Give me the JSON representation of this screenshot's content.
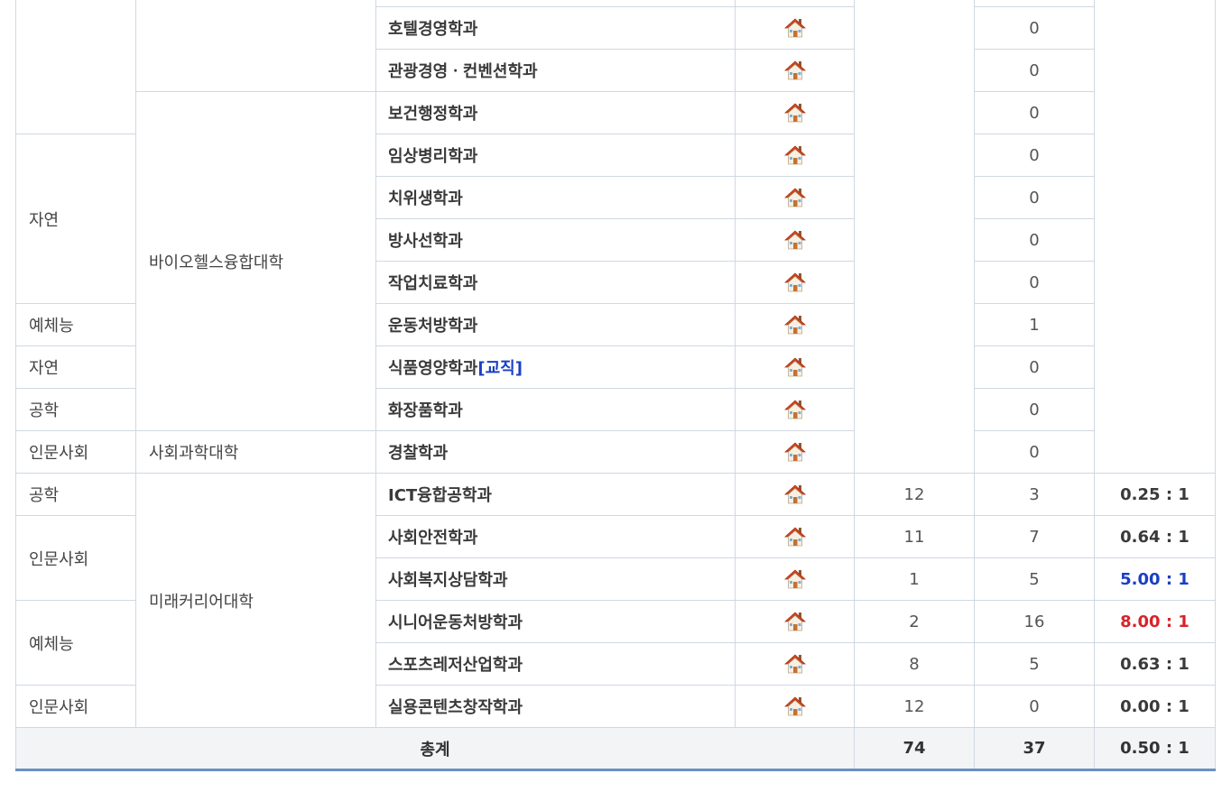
{
  "rows": [
    {
      "field": "",
      "college": "",
      "dept": "",
      "tag": "",
      "applicants": "",
      "count": "",
      "ratio": ""
    },
    {
      "field": "",
      "college": "",
      "dept": "호텔경영학과",
      "tag": "",
      "count": "0"
    },
    {
      "field": "",
      "college": "",
      "dept": "관광경영ㆍ컨벤션학과",
      "tag": "",
      "count": "0"
    },
    {
      "field": "",
      "college": "바이오헬스융합대학",
      "dept": "보건행정학과",
      "tag": "",
      "count": "0"
    },
    {
      "field": "자연",
      "college": "",
      "dept": "임상병리학과",
      "tag": "",
      "count": "0"
    },
    {
      "field": "",
      "college": "",
      "dept": "치위생학과",
      "tag": "",
      "count": "0"
    },
    {
      "field": "",
      "college": "",
      "dept": "방사선학과",
      "tag": "",
      "count": "0"
    },
    {
      "field": "",
      "college": "",
      "dept": "작업치료학과",
      "tag": "",
      "count": "0"
    },
    {
      "field": "예체능",
      "college": "",
      "dept": "운동처방학과",
      "tag": "",
      "count": "1"
    },
    {
      "field": "자연",
      "college": "",
      "dept": "식품영양학과",
      "tag": "[교직]",
      "count": "0"
    },
    {
      "field": "공학",
      "college": "",
      "dept": "화장품학과",
      "tag": "",
      "count": "0"
    },
    {
      "field": "인문사회",
      "college": "사회과학대학",
      "dept": "경찰학과",
      "tag": "",
      "count": "0"
    },
    {
      "field": "공학",
      "college": "미래커리어대학",
      "dept": "ICT융합공학과",
      "tag": "",
      "applicants": "12",
      "count": "3",
      "ratio": "0.25 : 1",
      "ratio_color": "default"
    },
    {
      "field": "인문사회",
      "college": "",
      "dept": "사회안전학과",
      "tag": "",
      "applicants": "11",
      "count": "7",
      "ratio": "0.64 : 1",
      "ratio_color": "default"
    },
    {
      "field": "",
      "college": "",
      "dept": "사회복지상담학과",
      "tag": "",
      "applicants": "1",
      "count": "5",
      "ratio": "5.00 : 1",
      "ratio_color": "blue"
    },
    {
      "field": "예체능",
      "college": "",
      "dept": "시니어운동처방학과",
      "tag": "",
      "applicants": "2",
      "count": "16",
      "ratio": "8.00 : 1",
      "ratio_color": "red"
    },
    {
      "field": "",
      "college": "",
      "dept": "스포츠레저산업학과",
      "tag": "",
      "applicants": "8",
      "count": "5",
      "ratio": "0.63 : 1",
      "ratio_color": "default"
    },
    {
      "field": "인문사회",
      "college": "",
      "dept": "실용콘텐츠창작학과",
      "tag": "",
      "applicants": "12",
      "count": "0",
      "ratio": "0.00 : 1",
      "ratio_color": "default"
    }
  ],
  "total": {
    "label": "총계",
    "applicants": "74",
    "count": "37",
    "ratio": "0.50 : 1"
  },
  "icons": {
    "home": "home-icon"
  },
  "colors": {
    "blue": "#1a3fc4",
    "red": "#d8232a",
    "default": "#3a3a3a",
    "border": "#cfd8e3",
    "total_border": "#6d8fc3"
  }
}
